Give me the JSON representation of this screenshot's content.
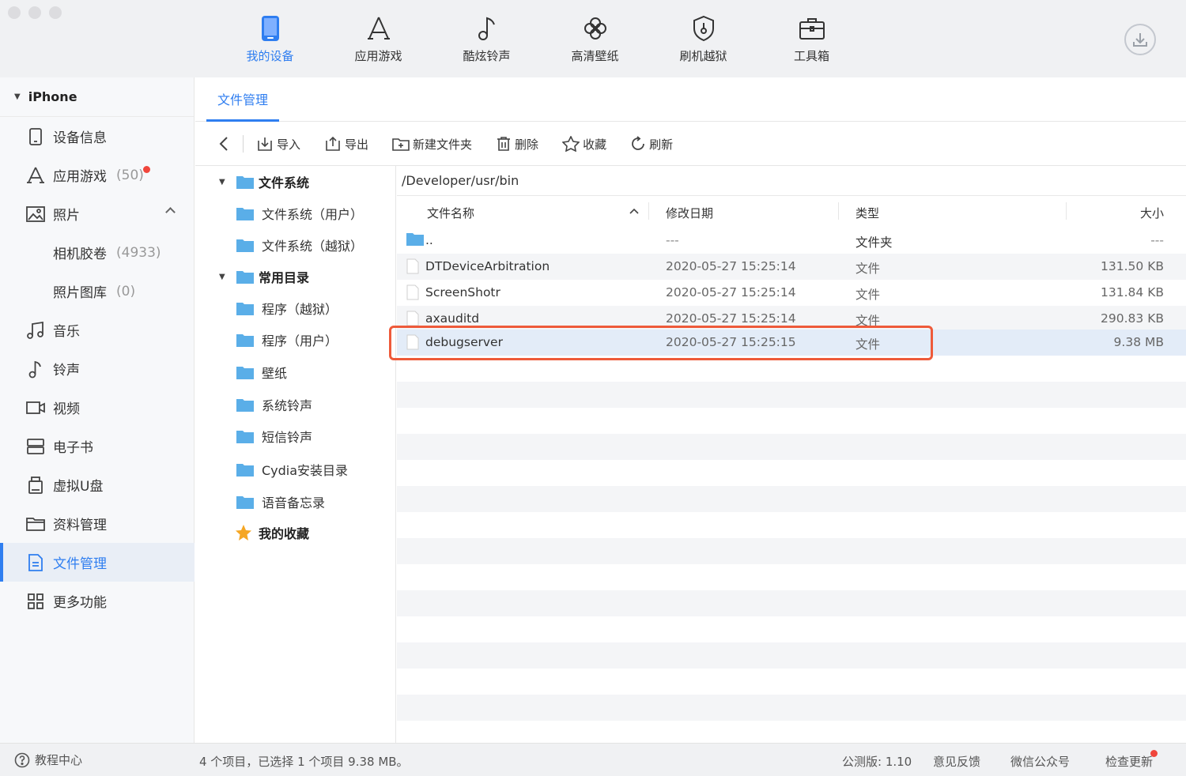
{
  "topnav": {
    "items": [
      {
        "label": "我的设备",
        "icon": "phone-icon",
        "active": true
      },
      {
        "label": "应用游戏",
        "icon": "app-store-icon"
      },
      {
        "label": "酷炫铃声",
        "icon": "music-note-icon"
      },
      {
        "label": "高清壁纸",
        "icon": "flower-icon"
      },
      {
        "label": "刷机越狱",
        "icon": "shield-icon"
      },
      {
        "label": "工具箱",
        "icon": "toolbox-icon"
      }
    ],
    "accent": "#2f7ef0"
  },
  "sidebar": {
    "device": "iPhone",
    "items": [
      {
        "label": "设备信息",
        "icon": "device-info-icon"
      },
      {
        "label": "应用游戏",
        "count": "(50)",
        "icon": "app-store-icon"
      },
      {
        "label": "照片",
        "icon": "photo-icon"
      },
      {
        "label": "相机胶卷",
        "count": "(4933)"
      },
      {
        "label": "照片图库",
        "count": "(0)"
      },
      {
        "label": "音乐",
        "icon": "music-icon"
      },
      {
        "label": "铃声",
        "icon": "ringtone-icon"
      },
      {
        "label": "视频",
        "icon": "video-icon"
      },
      {
        "label": "电子书",
        "icon": "ebook-icon"
      },
      {
        "label": "虚拟U盘",
        "icon": "usb-drive-icon"
      },
      {
        "label": "资料管理",
        "icon": "folder-icon"
      },
      {
        "label": "文件管理",
        "icon": "file-icon",
        "active": true
      },
      {
        "label": "更多功能",
        "icon": "grid-icon"
      }
    ]
  },
  "tab": {
    "label": "文件管理"
  },
  "toolbar": {
    "import": "导入",
    "export": "导出",
    "new_folder": "新建文件夹",
    "delete": "删除",
    "favorite": "收藏",
    "refresh": "刷新"
  },
  "tree": {
    "items": [
      {
        "label": "文件系统",
        "bold": true,
        "expanded": true
      },
      {
        "label": "文件系统（用户）"
      },
      {
        "label": "文件系统（越狱）"
      },
      {
        "label": "常用目录",
        "bold": true,
        "expanded": true
      },
      {
        "label": "程序（越狱）"
      },
      {
        "label": "程序（用户）"
      },
      {
        "label": "壁纸"
      },
      {
        "label": "系统铃声"
      },
      {
        "label": "短信铃声"
      },
      {
        "label": "Cydia安装目录"
      },
      {
        "label": "语音备忘录"
      },
      {
        "label": "我的收藏",
        "bold": true,
        "star": true
      }
    ]
  },
  "filepane": {
    "path": "/Developer/usr/bin",
    "columns": {
      "name": "文件名称",
      "date": "修改日期",
      "type": "类型",
      "size": "大小"
    },
    "rows": [
      {
        "name": "..",
        "date": "---",
        "type": "文件夹",
        "size": "---",
        "kind": "folder"
      },
      {
        "name": "DTDeviceArbitration",
        "date": "2020-05-27 15:25:14",
        "type": "文件",
        "size": "131.50 KB",
        "kind": "file"
      },
      {
        "name": "ScreenShotr",
        "date": "2020-05-27 15:25:14",
        "type": "文件",
        "size": "131.84 KB",
        "kind": "file"
      },
      {
        "name": "axauditd",
        "date": "2020-05-27 15:25:14",
        "type": "文件",
        "size": "290.83 KB",
        "kind": "file"
      },
      {
        "name": "debugserver",
        "date": "2020-05-27 15:25:15",
        "type": "文件",
        "size": "9.38 MB",
        "kind": "file",
        "selected": true
      }
    ]
  },
  "status": {
    "help": "教程中心",
    "summary": "4 个项目，已选择 1 个项目 9.38 MB。",
    "version": "公测版: 1.10",
    "feedback": "意见反馈",
    "wechat": "微信公众号",
    "update": "检查更新"
  }
}
